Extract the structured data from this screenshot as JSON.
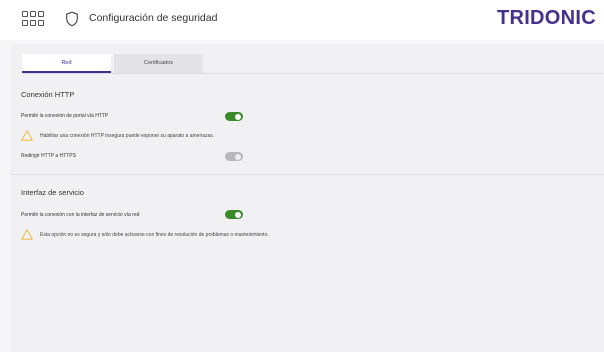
{
  "header": {
    "title": "Configuración de seguridad",
    "brand": "TRIDONIC",
    "brand_color": "#43308f",
    "apps_icon": "grid-icon",
    "page_icon": "shield-icon"
  },
  "tabs": [
    {
      "label": "Red",
      "active": true
    },
    {
      "label": "Certificados",
      "active": false
    }
  ],
  "http_section": {
    "title": "Conexión HTTP",
    "allow_http_label": "Permitir la conexión de portal vía HTTP",
    "allow_http_enabled": true,
    "warning": "Habilitar una conexión HTTP insegura puede exponer su aparato a amenazas.",
    "redirect_label": "Redirigir HTTP a HTTPS",
    "redirect_enabled": false
  },
  "service_section": {
    "title": "Interfaz de servicio",
    "allow_service_label": "Permitir la conexión con la interfaz de servicio vía red",
    "allow_service_enabled": true,
    "warning": "Esta opción no es segura y sólo debe activarse con fines de resolución de problemas o mantenimiento."
  },
  "colors": {
    "toggle_on": "#3a8a2a",
    "warning": "#f0b429"
  }
}
